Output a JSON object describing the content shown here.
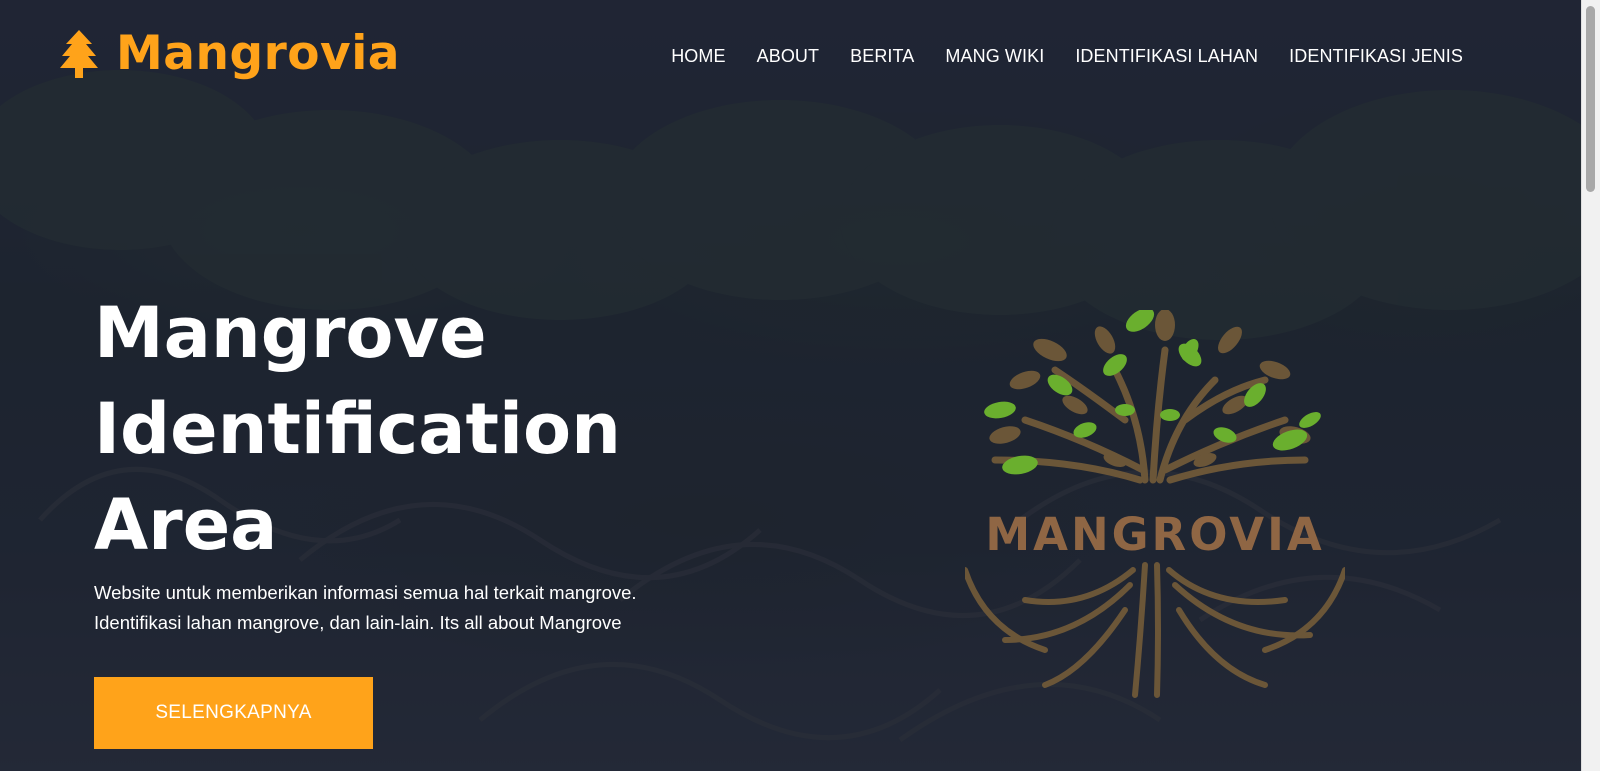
{
  "brand": {
    "name": "Mangrovia",
    "icon": "pine-tree-icon"
  },
  "nav": {
    "items": [
      {
        "label": "HOME"
      },
      {
        "label": "ABOUT"
      },
      {
        "label": "BERITA"
      },
      {
        "label": "MANG WIKI"
      },
      {
        "label": "IDENTIFIKASI LAHAN"
      },
      {
        "label": "IDENTIFIKASI JENIS"
      }
    ]
  },
  "hero": {
    "title_lines": [
      "Mangrove",
      "Identification",
      "Area"
    ],
    "description_lines": [
      "Website untuk memberikan informasi semua hal terkait mangrove.",
      "Identifikasi lahan mangrove, dan lain-lain. Its all about Mangrove"
    ],
    "cta_label": "SELENGKAPNYA"
  },
  "logo": {
    "word": "MANGROVIA",
    "icon": "mangrove-tree-logo"
  },
  "colors": {
    "accent": "#ffa31a",
    "logo_brown": "#8f6644",
    "leaf_green": "#6aaf2e",
    "overlay": "#1c2030"
  }
}
